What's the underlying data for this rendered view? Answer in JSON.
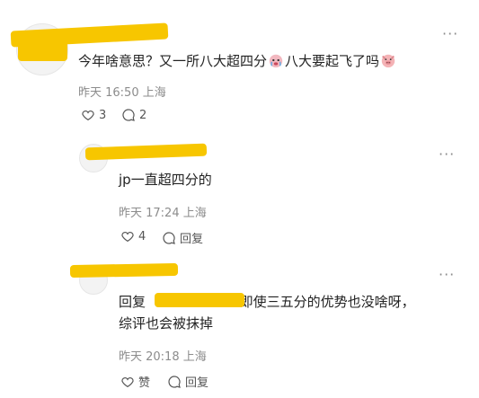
{
  "comments": [
    {
      "content": "今年啥意思？又一所八大超四分",
      "content_after_emoji": "八大要起飞了吗",
      "time": "昨天 16:50",
      "location": "上海",
      "likes": "3",
      "replies": "2"
    },
    {
      "content": "jp一直超四分的",
      "time": "昨天 17:24",
      "location": "上海",
      "likes": "4",
      "reply_label": "回复"
    },
    {
      "reply_prefix": "回复",
      "content_line1": ": 即使三五分的优势也没啥呀，",
      "content_line2": "综评也会被抹掉",
      "time": "昨天 20:18",
      "location": "上海",
      "like_label": "赞",
      "reply_label": "回复"
    }
  ],
  "more_glyph": "···",
  "icons": {
    "emoji1": "crying-face-emoji-icon",
    "emoji2": "pig-face-emoji-icon",
    "heart": "heart-icon",
    "comment": "comment-bubble-icon"
  }
}
